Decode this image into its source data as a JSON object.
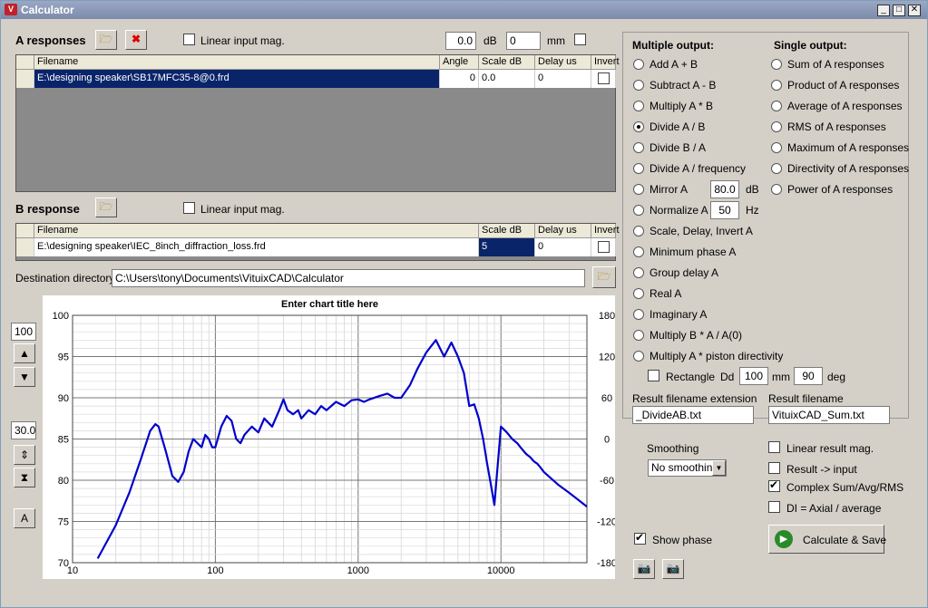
{
  "window": {
    "title": "Calculator"
  },
  "a_responses": {
    "label": "A responses",
    "linear_input_label": "Linear input mag.",
    "db_value": "0.0",
    "db_unit": "dB",
    "mm_value": "0",
    "mm_unit": "mm",
    "columns": [
      "Filename",
      "Angle",
      "Scale dB",
      "Delay us",
      "Invert"
    ],
    "rows": [
      {
        "filename": "E:\\designing speaker\\SB17MFC35-8@0.frd",
        "angle": "0",
        "scale": "0.0",
        "delay": "0"
      }
    ]
  },
  "b_response": {
    "label": "B response",
    "linear_input_label": "Linear input mag.",
    "columns": [
      "Filename",
      "Scale dB",
      "Delay us",
      "Invert"
    ],
    "rows": [
      {
        "filename": "E:\\designing speaker\\IEC_8inch_diffraction_loss.frd",
        "scale": "5",
        "delay": "0"
      }
    ]
  },
  "destination": {
    "label": "Destination directory",
    "path": "C:\\Users\\tony\\Documents\\VituixCAD\\Calculator"
  },
  "left_controls": {
    "top_value": "100",
    "range_value": "30.0",
    "auto_label": "A"
  },
  "multiple_output": {
    "title": "Multiple output:",
    "options": [
      "Add A + B",
      "Subtract A - B",
      "Multiply A * B",
      "Divide A / B",
      "Divide B / A",
      "Divide A / frequency",
      "Mirror A",
      "Normalize A",
      "Scale, Delay, Invert A",
      "Minimum phase A",
      "Group delay A",
      "Real A",
      "Imaginary A",
      "Multiply B * A / A(0)",
      "Multiply A * piston directivity"
    ],
    "selected": "Divide A / B",
    "mirror_value": "80.0",
    "mirror_unit": "dB",
    "normalize_value": "50",
    "normalize_unit": "Hz",
    "rectangle_label": "Rectangle",
    "dd_label": "Dd",
    "dd_value": "100",
    "dd_unit": "mm",
    "angle_value": "90",
    "angle_unit": "deg"
  },
  "single_output": {
    "title": "Single output:",
    "options": [
      "Sum of A responses",
      "Product of A responses",
      "Average of A responses",
      "RMS of A responses",
      "Maximum of A responses",
      "Directivity of A responses",
      "Power of A responses"
    ]
  },
  "result": {
    "ext_label": "Result filename extension",
    "ext_value": "_DivideAB.txt",
    "name_label": "Result filename",
    "name_value": "VituixCAD_Sum.txt"
  },
  "options": {
    "smoothing_label": "Smoothing",
    "smoothing_value": "No smoothing",
    "linear_result": "Linear result mag.",
    "result_input": "Result -> input",
    "complex_sum": "Complex Sum/Avg/RMS",
    "di_axial": "DI = Axial / average",
    "show_phase": "Show phase",
    "calc_button": "Calculate & Save"
  },
  "chart_data": {
    "type": "line",
    "title": "Enter chart title here",
    "x_scale": "log",
    "xlim": [
      10,
      40000
    ],
    "ylim": [
      70,
      100
    ],
    "y2lim": [
      -180,
      180
    ],
    "x_ticks": [
      "10",
      "100",
      "1000",
      "10000"
    ],
    "y_ticks": [
      "100",
      "95",
      "90",
      "85",
      "80",
      "75",
      "70"
    ],
    "y2_ticks": [
      "180",
      "120",
      "60",
      "0",
      "-60",
      "-120",
      "-180"
    ],
    "color": "#0000cc",
    "x": [
      15,
      20,
      25,
      30,
      35,
      38,
      40,
      45,
      50,
      55,
      60,
      65,
      70,
      75,
      80,
      85,
      90,
      95,
      100,
      110,
      120,
      130,
      140,
      150,
      160,
      180,
      200,
      220,
      250,
      280,
      300,
      320,
      350,
      380,
      400,
      450,
      500,
      550,
      600,
      700,
      800,
      900,
      1000,
      1100,
      1200,
      1400,
      1600,
      1800,
      2000,
      2300,
      2600,
      3000,
      3500,
      4000,
      4500,
      5000,
      5500,
      6000,
      6500,
      7000,
      7500,
      8000,
      8500,
      9000,
      10000,
      11000,
      12000,
      13000,
      14000,
      15000,
      16000,
      17000,
      18000,
      19000,
      20000,
      25000,
      30000,
      40000
    ],
    "y": [
      70.5,
      74.5,
      78.5,
      82.5,
      86.0,
      86.8,
      86.5,
      83.5,
      80.5,
      79.8,
      81.0,
      83.5,
      85.0,
      84.5,
      84.0,
      85.5,
      85.0,
      84.0,
      84.0,
      86.5,
      87.8,
      87.2,
      85.0,
      84.5,
      85.5,
      86.5,
      85.8,
      87.5,
      86.5,
      88.5,
      89.8,
      88.5,
      88.0,
      88.5,
      87.5,
      88.5,
      88.0,
      89.0,
      88.5,
      89.5,
      89.0,
      89.7,
      89.8,
      89.5,
      89.8,
      90.2,
      90.5,
      90.0,
      90.0,
      91.5,
      93.5,
      95.5,
      97.0,
      95.0,
      96.7,
      95.0,
      93.0,
      89.0,
      89.2,
      87.5,
      85.0,
      82.0,
      79.5,
      77.0,
      86.5,
      85.8,
      85.0,
      84.5,
      83.8,
      83.2,
      82.8,
      82.3,
      82.0,
      81.5,
      81.0,
      79.5,
      78.5,
      76.8
    ]
  }
}
